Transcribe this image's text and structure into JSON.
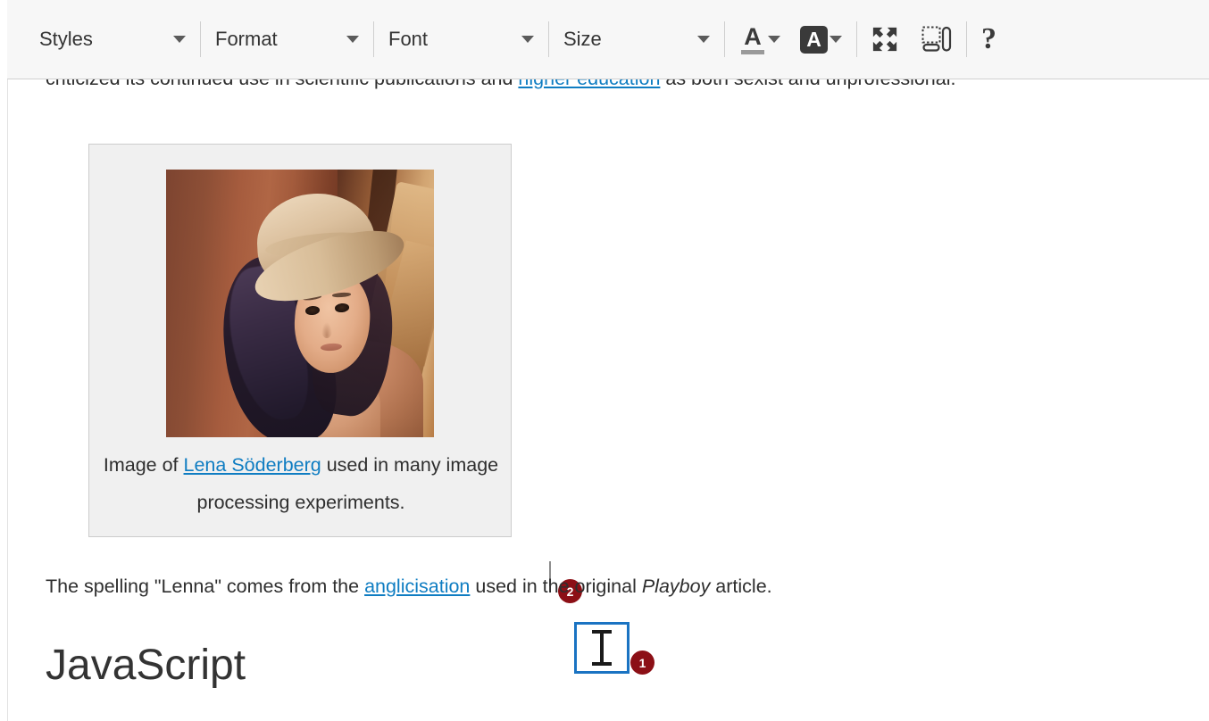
{
  "toolbar": {
    "combos": [
      {
        "label": "Styles",
        "name": "styles-combo"
      },
      {
        "label": "Format",
        "name": "format-combo"
      },
      {
        "label": "Font",
        "name": "font-combo"
      },
      {
        "label": "Size",
        "name": "size-combo"
      }
    ],
    "buttons": [
      {
        "label": "Text Color",
        "icon": "text-color-icon",
        "glyph": "A"
      },
      {
        "label": "Background Color",
        "icon": "background-color-icon",
        "glyph": "A"
      },
      {
        "label": "Maximize",
        "icon": "maximize-icon"
      },
      {
        "label": "Show Blocks",
        "icon": "show-blocks-icon"
      },
      {
        "label": "About CKEditor",
        "icon": "help-icon",
        "glyph": "?"
      }
    ],
    "colors": {
      "background": "#f7f7f7",
      "border": "#d1d1d1",
      "icon": "#3a3a3a"
    }
  },
  "document": {
    "paragraph_top": {
      "before_link": "criticized its continued use in scientific publications and ",
      "link": "higher education",
      "after_link": " as both sexist and unprofessional."
    },
    "figure": {
      "image_alt": "Lenna test image",
      "caption_before_link": "Image of ",
      "caption_link": "Lena Söderberg",
      "caption_after_link": " used in many image processing experiments."
    },
    "paragraph_spelling": {
      "before_link": "The spelling \"Lenna\" comes from the ",
      "link": "anglicisation",
      "middle": " used in the original ",
      "italic": "Playboy",
      "after": " article."
    },
    "heading": "JavaScript",
    "colors": {
      "link": "#0f7dc2",
      "text": "#2e2e2e",
      "figure_background": "#f0f0f0",
      "figure_border": "#cccccc"
    }
  },
  "annotations": {
    "marker_1": "1",
    "marker_2": "2",
    "marker_color": "#8c0f16",
    "cursor_box_color": "#1a73c2",
    "cursor_type": "text-ibeam",
    "caret_color": "#8d8d8d"
  }
}
